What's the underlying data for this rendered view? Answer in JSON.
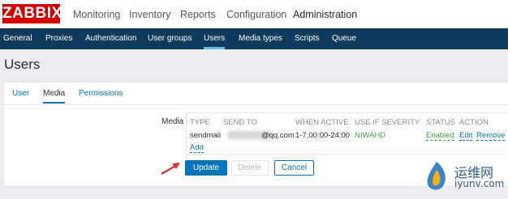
{
  "logo": "ZABBIX",
  "main_menu": [
    "Monitoring",
    "Inventory",
    "Reports",
    "Configuration",
    "Administration"
  ],
  "sub_menu": [
    "General",
    "Proxies",
    "Authentication",
    "User groups",
    "Users",
    "Media types",
    "Scripts",
    "Queue"
  ],
  "page_title": "Users",
  "tabs": [
    "User",
    "Media",
    "Permissions"
  ],
  "media": {
    "label": "Media",
    "columns": [
      "TYPE",
      "SEND TO",
      "WHEN ACTIVE",
      "USE IF SEVERITY",
      "STATUS",
      "ACTION"
    ],
    "row": {
      "type": "sendmail",
      "send_to": "@qq.com",
      "when_active": "1-7,00:00-24:00",
      "severity": "NIWAHD",
      "status": "Enabled",
      "edit": "Edit",
      "remove": "Remove"
    },
    "add": "Add"
  },
  "buttons": {
    "update": "Update",
    "delete": "Delete",
    "cancel": "Cancel"
  },
  "watermark": {
    "text": "运维网",
    "url": "iyunv.com"
  },
  "colors": {
    "brand": "#d40000",
    "subnav": "#0e3a5b",
    "link": "#0275b8",
    "enabled": "#429e47"
  }
}
